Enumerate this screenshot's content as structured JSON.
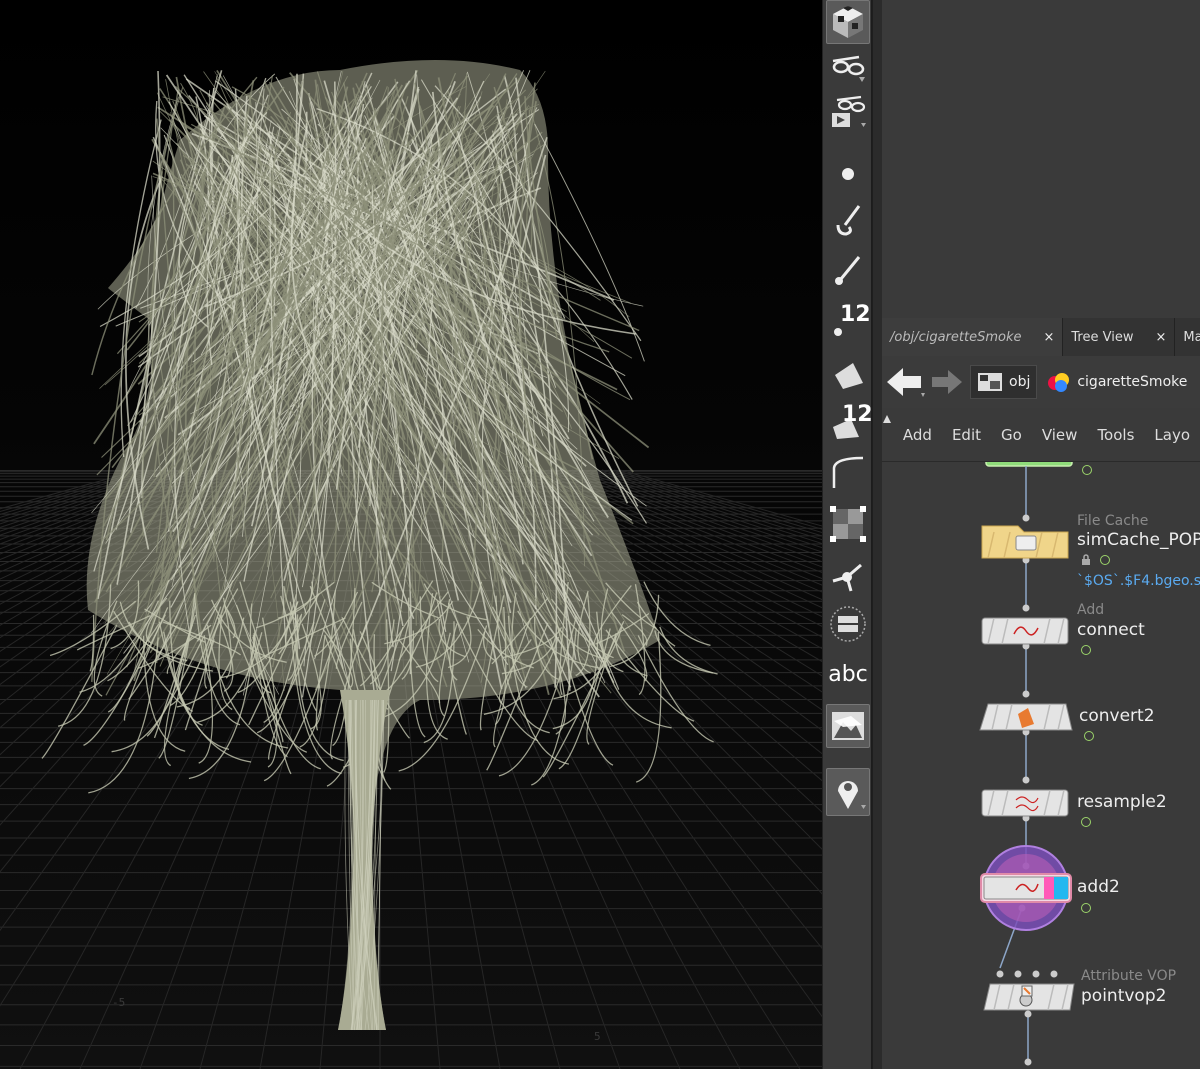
{
  "viewport": {
    "axis_labels": [
      "-5",
      "5"
    ],
    "geometry_color": "#a9ab93"
  },
  "shelf": {
    "tools": [
      {
        "icon": "cube-icon"
      },
      {
        "icon": "view-glasses-icon"
      },
      {
        "icon": "view-camera-glasses-icon"
      },
      {
        "icon": "point-icon"
      },
      {
        "icon": "brush-icon"
      },
      {
        "icon": "pin-tool-icon"
      },
      {
        "icon": "point-number-icon",
        "label": "12"
      },
      {
        "icon": "primitive-icon"
      },
      {
        "icon": "primitive-number-icon",
        "label": "12"
      },
      {
        "icon": "curve-icon"
      },
      {
        "icon": "checker-icon"
      },
      {
        "icon": "normals-icon"
      },
      {
        "icon": "circle-frame-icon"
      },
      {
        "icon": "text-abc-icon",
        "label": "abc"
      },
      {
        "icon": "background-image-icon"
      },
      {
        "icon": "location-pin-icon"
      }
    ]
  },
  "tabs": [
    {
      "label": "/obj/cigaretteSmoke",
      "close": "×"
    },
    {
      "label": "Tree View",
      "close": "×"
    },
    {
      "label": "Materi"
    }
  ],
  "navbar": {
    "crumb_obj": "obj",
    "crumb_node": "cigaretteSmoke"
  },
  "menu": [
    "Add",
    "Edit",
    "Go",
    "View",
    "Tools",
    "Layo"
  ],
  "nodes": [
    {
      "type": "File Cache",
      "name": "simCache_POP",
      "expr": "`$OS`.$F4.bgeo.s"
    },
    {
      "type": "Add",
      "name": "connect"
    },
    {
      "type": "",
      "name": "convert2"
    },
    {
      "type": "",
      "name": "resample2"
    },
    {
      "type": "",
      "name": "add2"
    },
    {
      "type": "Attribute VOP",
      "name": "pointvop2"
    }
  ],
  "colors": {
    "file_cache_node": "#f0d58a",
    "selected_ring": "#8a5fc8",
    "flag_green": "#9bd46a",
    "expr_blue": "#5aaaf0"
  }
}
